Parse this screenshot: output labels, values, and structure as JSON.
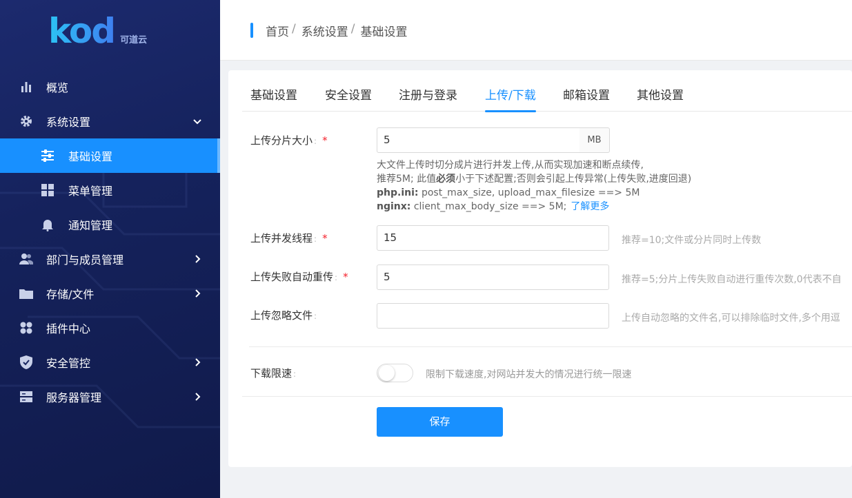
{
  "logo": {
    "word": "kod",
    "cn": "可道云"
  },
  "sidebar": {
    "items": [
      {
        "label": "概览",
        "icon": "bar-chart-icon"
      },
      {
        "label": "系统设置",
        "icon": "gear-icon",
        "expanded": true
      },
      {
        "label": "基础设置",
        "icon": "sliders-icon",
        "active": true
      },
      {
        "label": "菜单管理",
        "icon": "grid-icon"
      },
      {
        "label": "通知管理",
        "icon": "bell-icon"
      },
      {
        "label": "部门与成员管理",
        "icon": "users-icon"
      },
      {
        "label": "存储/文件",
        "icon": "folder-icon"
      },
      {
        "label": "插件中心",
        "icon": "plugin-icon"
      },
      {
        "label": "安全管控",
        "icon": "shield-icon"
      },
      {
        "label": "服务器管理",
        "icon": "server-icon"
      }
    ]
  },
  "breadcrumb": {
    "home": "首页",
    "level1": "系统设置",
    "current": "基础设置",
    "sep": "/"
  },
  "tabs": [
    "基础设置",
    "安全设置",
    "注册与登录",
    "上传/下载",
    "邮箱设置",
    "其他设置"
  ],
  "active_tab": 3,
  "form": {
    "chunk_size": {
      "label": "上传分片大小",
      "value": "5",
      "unit": "MB",
      "desc_line1": "大文件上传时切分成片进行并发上传,从而实现加速和断点续传,",
      "desc_line2_a": "推荐5M; 此值",
      "desc_line2_b": "必须",
      "desc_line2_c": "小于下述配置;否则会引起上传异常(上传失败,进度回退)",
      "desc_php_key": "php.ini:",
      "desc_php_val": " post_max_size, upload_max_filesize ==> 5M",
      "desc_nginx_key": "nginx:",
      "desc_nginx_val": " client_max_body_size ==> 5M;",
      "learn_more": "了解更多"
    },
    "threads": {
      "label": "上传并发线程",
      "value": "15",
      "help": "推荐=10;文件或分片同时上传数"
    },
    "retry": {
      "label": "上传失败自动重传",
      "value": "5",
      "help": "推荐=5;分片上传失败自动进行重传次数,0代表不自"
    },
    "ignore": {
      "label": "上传忽略文件",
      "value": "",
      "help": "上传自动忽略的文件名,可以排除临时文件,多个用逗"
    },
    "download_limit": {
      "label": "下载限速",
      "enabled": false,
      "help": "限制下载速度,对网站并发大的情况进行统一限速"
    },
    "required_mark": "*",
    "colon": ":",
    "save": "保存"
  },
  "colors": {
    "accent": "#1890ff",
    "sidebar_bg": "#15225c",
    "required": "#f5222d"
  }
}
